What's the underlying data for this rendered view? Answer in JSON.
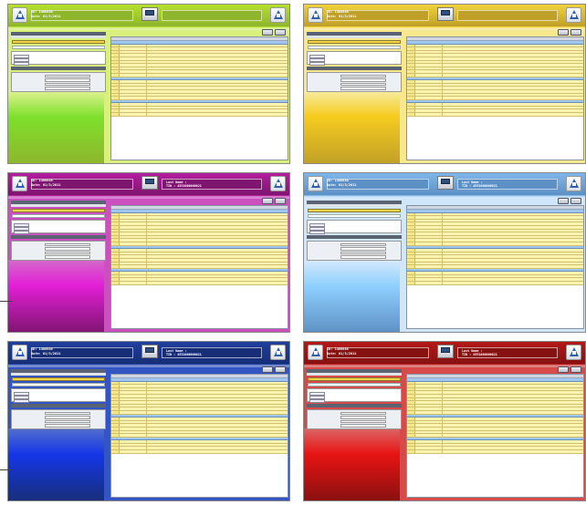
{
  "panels": [
    {
      "theme": "green",
      "colors": {
        "top": "#b5e02d",
        "bar": "#8fb52c",
        "bg": "#d9f07c",
        "wave": "#7ee02c"
      },
      "app_title": "",
      "patient": {
        "line1": "ID: 1480888",
        "line2": "Date: 01/3/2011"
      },
      "last": null
    },
    {
      "theme": "yellow",
      "colors": {
        "top": "#f2d23a",
        "bar": "#bfa028",
        "bg": "#f7e88d",
        "wave": "#f5cb1e"
      },
      "app_title": "",
      "patient": {
        "line1": "ID: 1480888",
        "line2": "Date: 01/3/2011"
      },
      "last": null
    },
    {
      "theme": "magenta",
      "colors": {
        "top": "#b31e9e",
        "bar": "#7e156f",
        "bg": "#cc4fc0",
        "wave": "#e21fd6"
      },
      "app_title": "",
      "patient": {
        "line1": "ID: 1480888",
        "line2": "Date: 01/3/2011"
      },
      "last": {
        "line1": "Last Name :",
        "line2": "TIN : 4551000000021"
      }
    },
    {
      "theme": "lightblue",
      "colors": {
        "top": "#7fb7ea",
        "bar": "#5d90c4",
        "bg": "#cfe6fb",
        "wave": "#8fd0ff"
      },
      "app_title": "",
      "patient": {
        "line1": "ID: 1480888",
        "line2": "Date: 01/3/2011"
      },
      "last": {
        "line1": "Last Name :",
        "line2": "TIN : 4551000000021"
      }
    },
    {
      "theme": "blue",
      "colors": {
        "top": "#1f3f9e",
        "bar": "#172e76",
        "bg": "#3355c4",
        "wave": "#1636e8"
      },
      "app_title": "",
      "patient": {
        "line1": "ID: 1480888",
        "line2": "Date: 01/3/2011"
      },
      "last": {
        "line1": "Last Name :",
        "line2": "TIN : 4551000000021"
      }
    },
    {
      "theme": "red",
      "colors": {
        "top": "#b51818",
        "bar": "#861111",
        "bg": "#d64a4a",
        "wave": "#e81313"
      },
      "app_title": "",
      "patient": {
        "line1": "ID: 1480888",
        "line2": "Date: 01/3/2011"
      },
      "last": {
        "line1": "Last Name :",
        "line2": "TIN : 4551000000021"
      }
    }
  ],
  "icons": {
    "logo": "triangle-logo-icon",
    "scanner": "scanner-icon"
  }
}
